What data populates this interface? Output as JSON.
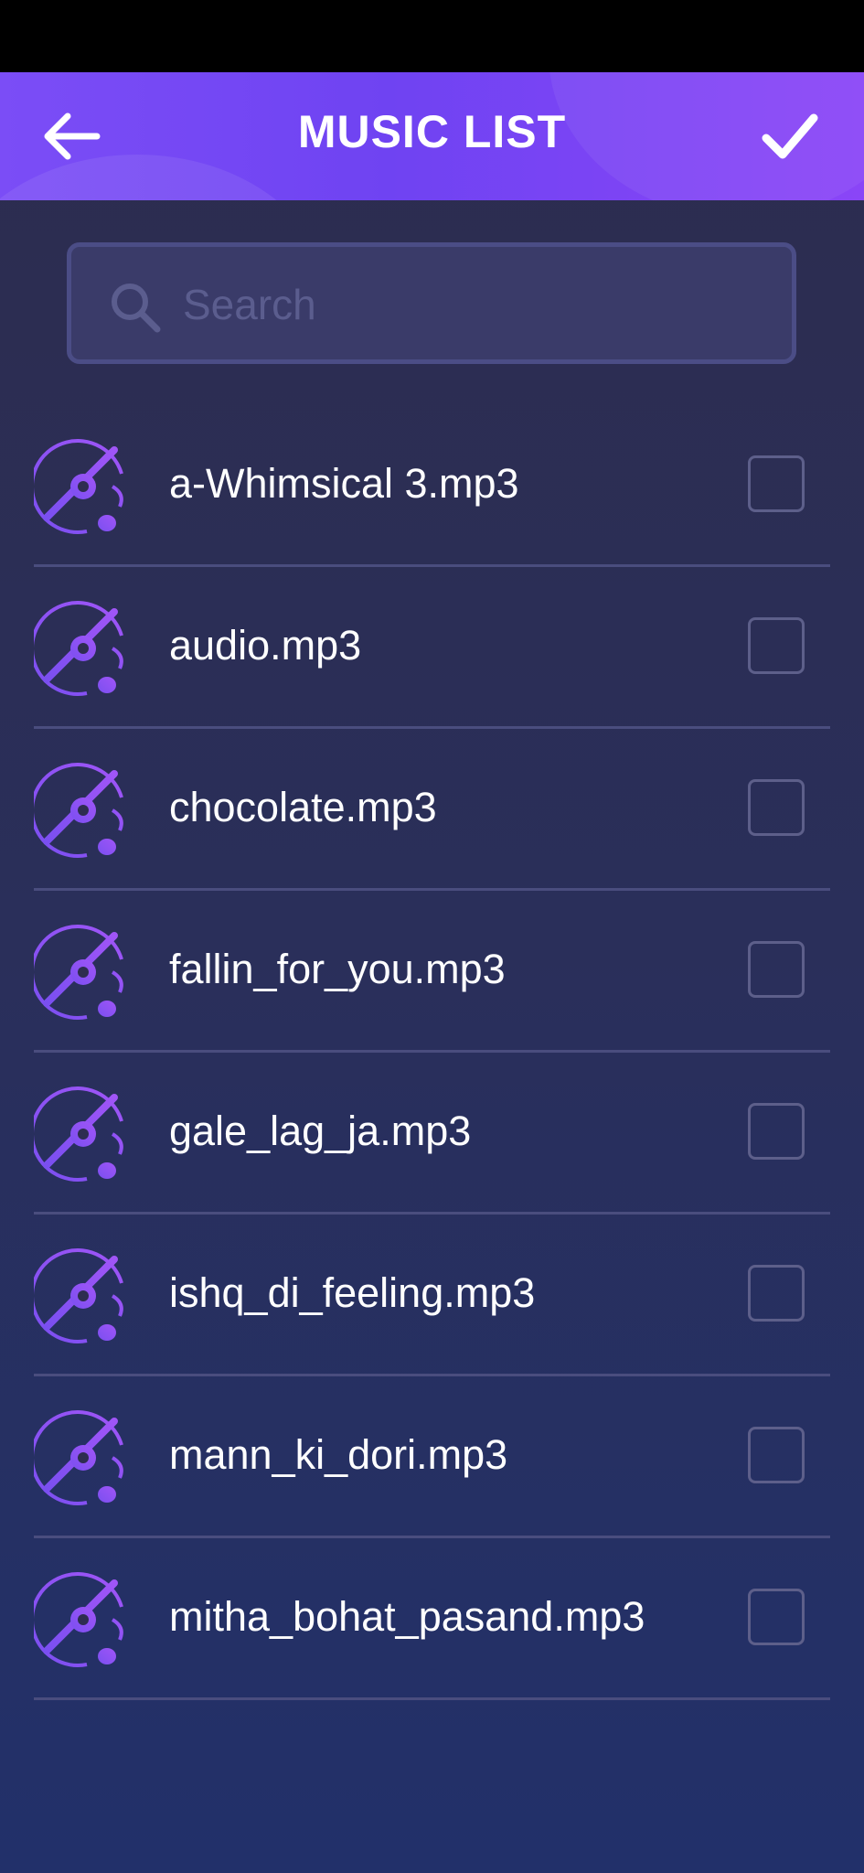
{
  "header": {
    "title": "MUSIC LIST",
    "back_icon": "arrow-left-icon",
    "confirm_icon": "checkmark-icon"
  },
  "search": {
    "placeholder": "Search",
    "value": "",
    "icon": "search-icon"
  },
  "colors": {
    "header_gradient_start": "#7b4df6",
    "header_gradient_end": "#8a45f7",
    "background_top": "#2d2c4e",
    "background_bottom": "#22306a",
    "accent_purple": "#8f5cf7",
    "divider": "#4a4d7e",
    "checkbox_border": "#5d5f8a"
  },
  "music_list": {
    "items": [
      {
        "name": "a-Whimsical 3.mp3",
        "checked": false,
        "icon": "music-disc-icon"
      },
      {
        "name": "audio.mp3",
        "checked": false,
        "icon": "music-disc-icon"
      },
      {
        "name": "chocolate.mp3",
        "checked": false,
        "icon": "music-disc-icon"
      },
      {
        "name": "fallin_for_you.mp3",
        "checked": false,
        "icon": "music-disc-icon"
      },
      {
        "name": "gale_lag_ja.mp3",
        "checked": false,
        "icon": "music-disc-icon"
      },
      {
        "name": "ishq_di_feeling.mp3",
        "checked": false,
        "icon": "music-disc-icon"
      },
      {
        "name": "mann_ki_dori.mp3",
        "checked": false,
        "icon": "music-disc-icon"
      },
      {
        "name": "mitha_bohat_pasand.mp3",
        "checked": false,
        "icon": "music-disc-icon"
      }
    ]
  }
}
